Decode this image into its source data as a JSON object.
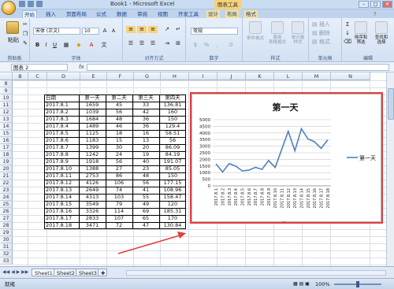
{
  "window": {
    "title": "Book1 - Microsoft Excel",
    "context_tab": "图表工具"
  },
  "ribbon_tabs": [
    "开始",
    "插入",
    "页面布局",
    "公式",
    "数据",
    "审阅",
    "视图",
    "开发工具",
    "设计",
    "布局",
    "格式"
  ],
  "ribbon": {
    "paste_label": "粘贴",
    "font_name": "宋体 (正文)",
    "font_size": "10",
    "number_format": "常规",
    "conditional_format": "条件格式",
    "format_as_table": "套用\n表格格式",
    "cell_styles": "单元格\n样式",
    "insert_label": "插入",
    "delete_label": "删除",
    "format_label": "格式",
    "sort_filter": "排序和\n筛选",
    "find_select": "查找和\n选择",
    "groups": {
      "clipboard": "剪贴板",
      "font": "字体",
      "alignment": "对齐方式",
      "number": "数字",
      "styles": "样式",
      "cells": "单元格",
      "editing": "编辑"
    }
  },
  "formula_bar": {
    "name_box": "图表 2",
    "fx": "fx",
    "content": ""
  },
  "columns": [
    "B",
    "C",
    "D",
    "E",
    "F",
    "G",
    "H",
    "I",
    "J",
    "K",
    "L",
    "M",
    "N"
  ],
  "rows": [
    "8",
    "9",
    "10",
    "11",
    "12",
    "13",
    "14",
    "15",
    "16",
    "17",
    "18",
    "19",
    "20",
    "21",
    "22",
    "23",
    "24",
    "25",
    "26",
    "27",
    "28",
    "29",
    "30",
    "31",
    "32",
    "33"
  ],
  "table": {
    "headers": [
      "日期",
      "第一天",
      "第二天",
      "第三天",
      "第四天"
    ],
    "rows": [
      [
        "2017.8.1",
        "1659",
        "45",
        "33",
        "136.81"
      ],
      [
        "2017.8.2",
        "1039",
        "56",
        "42",
        "160"
      ],
      [
        "2017.8.3",
        "1684",
        "48",
        "36",
        "150"
      ],
      [
        "2017.8.4",
        "1489",
        "46",
        "36",
        "129.4"
      ],
      [
        "2017.8.5",
        "1125",
        "18",
        "16",
        "58.51"
      ],
      [
        "2017.8.6",
        "1183",
        "15",
        "13",
        "56"
      ],
      [
        "2017.8.7",
        "1399",
        "30",
        "20",
        "86.09"
      ],
      [
        "2017.8.8",
        "1242",
        "24",
        "19",
        "84.19"
      ],
      [
        "2017.8.9",
        "1918",
        "56",
        "40",
        "191.07"
      ],
      [
        "2017.8.10",
        "1388",
        "27",
        "23",
        "85.05"
      ],
      [
        "2017.8.11",
        "2753",
        "86",
        "48",
        "150"
      ],
      [
        "2017.8.12",
        "4126",
        "106",
        "56",
        "177.15"
      ],
      [
        "2017.8.13",
        "2649",
        "74",
        "41",
        "108.96"
      ],
      [
        "2017.8.14",
        "4313",
        "103",
        "55",
        "158.47"
      ],
      [
        "2017.8.15",
        "3549",
        "79",
        "49",
        "120"
      ],
      [
        "2017.8.16",
        "3326",
        "114",
        "69",
        "185.31"
      ],
      [
        "2017.8.17",
        "2833",
        "107",
        "65",
        "170"
      ],
      [
        "2017.8.18",
        "3471",
        "72",
        "47",
        "130.84"
      ]
    ]
  },
  "chart_data": {
    "type": "line",
    "title": "第一天",
    "categories": [
      "2017.8.1",
      "2017.8.2",
      "2017.8.3",
      "2017.8.4",
      "2017.8.5",
      "2017.8.6",
      "2017.8.7",
      "2017.8.8",
      "2017.8.9",
      "2017.8.10",
      "2017.8.11",
      "2017.8.12",
      "2017.8.13",
      "2017.8.14",
      "2017.8.15",
      "2017.8.16",
      "2017.8.17",
      "2017.8.18"
    ],
    "series": [
      {
        "name": "第一天",
        "values": [
          1659,
          1039,
          1684,
          1489,
          1125,
          1183,
          1399,
          1242,
          1918,
          1388,
          2753,
          4126,
          2649,
          4313,
          3549,
          3326,
          2833,
          3471
        ],
        "color": "#4f81bd"
      }
    ],
    "ylim": [
      0,
      5000
    ],
    "yticks": [
      "0",
      "500",
      "1000",
      "1500",
      "2000",
      "2500",
      "3000",
      "3500",
      "4000",
      "4500",
      "5000"
    ],
    "grid": true,
    "legend": "right"
  },
  "sheet_tabs": [
    "Sheet1",
    "Sheet2",
    "Sheet3"
  ],
  "status": {
    "ready": "就绪",
    "zoom": "100%"
  },
  "colors": {
    "accent": "#e33e3e",
    "series": "#4f81bd"
  }
}
